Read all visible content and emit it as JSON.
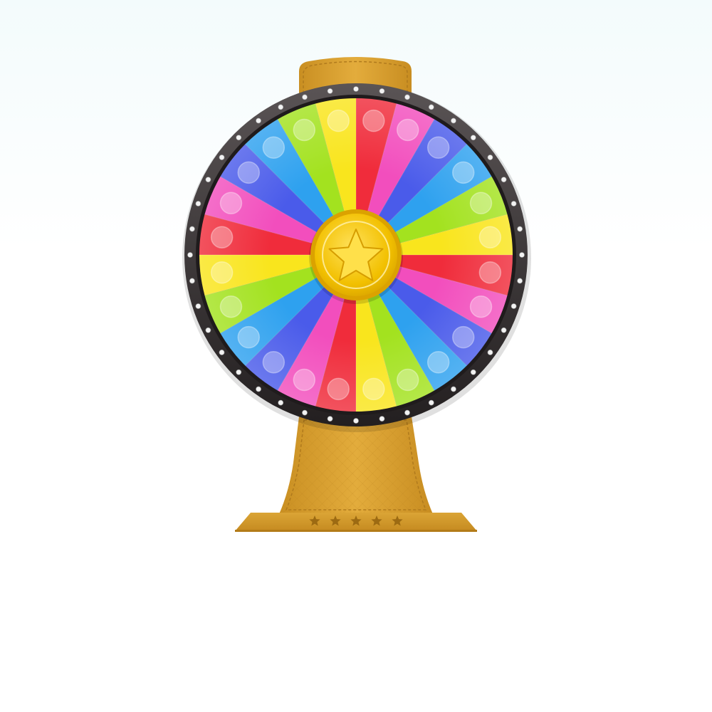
{
  "wheel": {
    "segment_count": 24,
    "segment_colors": [
      "#f02c3b",
      "#f24ebd",
      "#4a5bea",
      "#2ea1ef",
      "#a3e21f",
      "#f9e51d",
      "#f02c3b",
      "#f24ebd",
      "#4a5bea",
      "#2ea1ef",
      "#a3e21f",
      "#f9e51d",
      "#f02c3b",
      "#f24ebd",
      "#4a5bea",
      "#2ea1ef",
      "#a3e21f",
      "#f9e51d",
      "#f02c3b",
      "#f24ebd",
      "#4a5bea",
      "#2ea1ef",
      "#a3e21f",
      "#f9e51d"
    ],
    "rim_color": "#3a3536",
    "rim_stud_count": 40,
    "rim_stud_color": "#f2f2f2",
    "hub_color": "#f4c400",
    "hub_icon": "star-icon"
  },
  "stand": {
    "color": "#d9a12e",
    "stitch_color": "#b07a1d",
    "base_star_count": 5,
    "base_star_icon": "star-icon"
  }
}
